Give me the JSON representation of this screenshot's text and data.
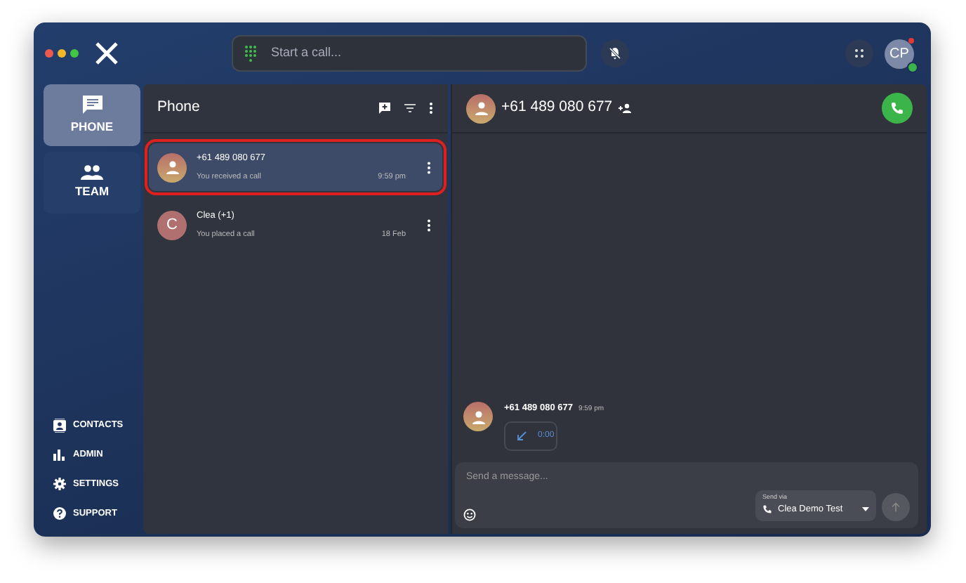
{
  "search": {
    "placeholder": "Start a call..."
  },
  "user": {
    "initials": "CP"
  },
  "nav": [
    {
      "label": "PHONE",
      "selected": true
    },
    {
      "label": "TEAM",
      "selected": false
    }
  ],
  "bottom_nav": [
    {
      "label": "CONTACTS"
    },
    {
      "label": "ADMIN"
    },
    {
      "label": "SETTINGS"
    },
    {
      "label": "SUPPORT"
    }
  ],
  "list": {
    "title": "Phone",
    "conversations": [
      {
        "name": "+61 489 080 677",
        "subtitle": "You received a call",
        "time": "9:59 pm",
        "selected": true,
        "outlined": true
      },
      {
        "name": "Clea (+1)",
        "subtitle": "You placed a call",
        "time": "18 Feb",
        "avatar": "C",
        "selected": false,
        "outlined": false
      }
    ]
  },
  "chat": {
    "title": "+61 489 080 677",
    "messages": [
      {
        "sender": "+61 489 080 677",
        "time": "9:59 pm",
        "call_duration": "0:00"
      }
    ],
    "composer": {
      "placeholder": "Send a message...",
      "send_via_label": "Send via",
      "send_via_value": "Clea Demo Test"
    }
  }
}
